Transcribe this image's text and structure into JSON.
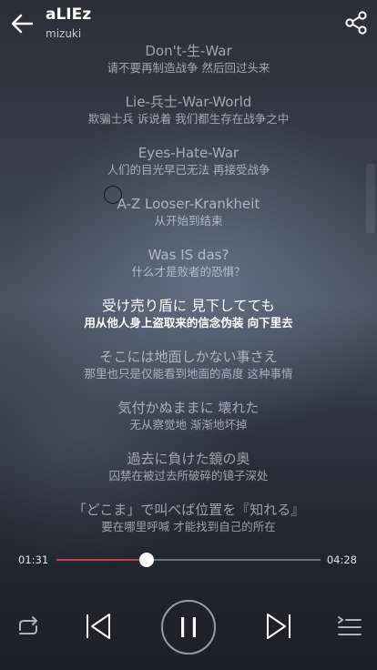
{
  "header": {
    "title": "aLIEz",
    "artist": "mizuki"
  },
  "lyrics": [
    {
      "orig": "Don't-生-War",
      "trans": "请不要再制造战争 然后回过头来"
    },
    {
      "orig": "Lie-兵士-War-World",
      "trans": "欺骗士兵 诉说着 我们都生存在战争之中"
    },
    {
      "orig": "Eyes-Hate-War",
      "trans": "人们的目光早已无法 再接受战争"
    },
    {
      "orig": "A-Z Looser-Krankheit",
      "trans": "从开始到结束"
    },
    {
      "orig": "Was IS das?",
      "trans": "什么才是败者的恐惧？"
    },
    {
      "orig": "受け売り盾に 見下してても",
      "trans": "用从他人身上盗取来的信念伪装 向下里去",
      "active": true
    },
    {
      "orig": "そこには地面しかない事さえ",
      "trans": "那里也只是仅能看到地面的高度 这种事情"
    },
    {
      "orig": "気付かぬままに 壊れた",
      "trans": "无从察觉地 渐渐地坏掉"
    },
    {
      "orig": "過去に負けた鏡の奥",
      "trans": "囚禁在被过去所破碎的镜子深处"
    },
    {
      "orig": "「どこま」で叫べば位置を『知れる』",
      "trans": "要在哪里呼喊 才能找到自己的所在"
    }
  ],
  "player": {
    "current_time": "01:31",
    "total_time": "04:28",
    "progress": 0.34
  },
  "icons": {
    "back": "arrow-left-icon",
    "share": "share-icon",
    "repeat": "repeat-icon",
    "previous": "skip-previous-icon",
    "pause": "pause-icon",
    "next": "skip-next-icon",
    "playlist": "playlist-icon"
  },
  "colors": {
    "accent": "#d33b3b",
    "active_text": "#ffffff"
  }
}
